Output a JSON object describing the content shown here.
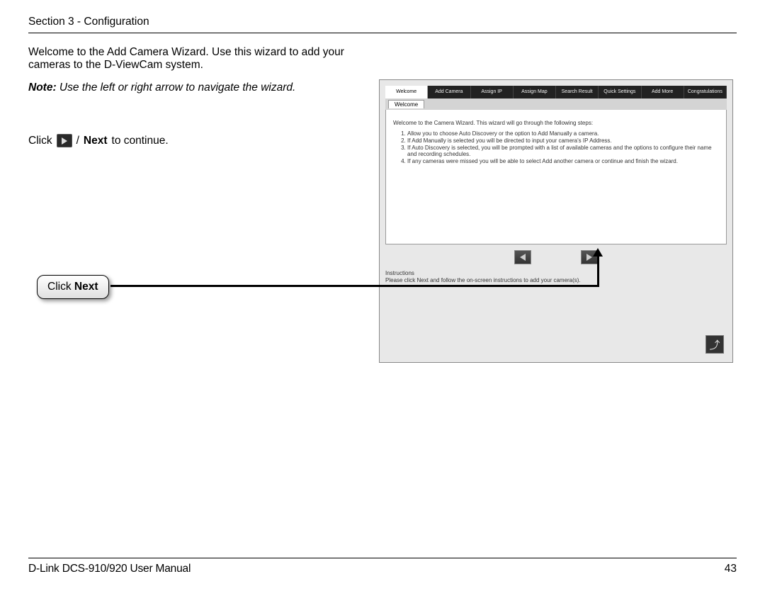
{
  "header": {
    "section": "Section 3 - Configuration"
  },
  "body": {
    "intro": "Welcome to the Add Camera Wizard. Use this wizard to add your cameras to the D-ViewCam system.",
    "note_prefix": "Note:",
    "note_text": " Use the left or right arrow to navigate the wizard.",
    "click_pre": "Click",
    "click_slash": "/",
    "click_next": "Next",
    "click_post": " to continue."
  },
  "callout": {
    "pre": "Click ",
    "bold": "Next"
  },
  "screenshot": {
    "tabs": [
      "Welcome",
      "Add Camera",
      "Assign IP",
      "Assign Map",
      "Search Result",
      "Quick Settings",
      "Add More",
      "Congratulations"
    ],
    "inner_tab": "Welcome",
    "wizard_text": "Welcome to the Camera Wizard. This wizard will go through the following steps:",
    "steps": [
      "Allow you to choose Auto Discovery or the option to Add Manually a camera.",
      "If Add Manually is selected you will be directed to input your camera's IP Address.",
      "If Auto Discovery is selected, you will be prompted with a list of available cameras and the options to configure their name and recording schedules.",
      "If any cameras were missed you will be able to select Add another camera or continue and finish the wizard."
    ],
    "instructions_title": "Instructions",
    "instructions_text": "Please click Next and follow the on-screen instructions to add your camera(s).",
    "exit_glyph": "⤴"
  },
  "footer": {
    "manual": "D-Link DCS-910/920 User Manual",
    "page": "43"
  }
}
